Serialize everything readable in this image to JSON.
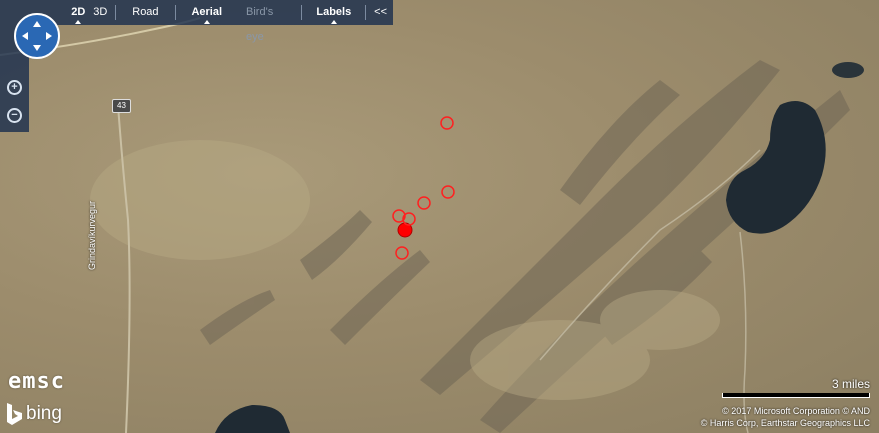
{
  "toolbar": {
    "view_2d": "2D",
    "view_3d": "3D",
    "road": "Road",
    "aerial": "Aerial",
    "birds_eye": "Bird's eye",
    "labels": "Labels",
    "collapse": "<<"
  },
  "map": {
    "route_shield": "43",
    "road_name": "Grindavíkurvegur",
    "scale_label": "3 miles",
    "copyright_line1": "© 2017 Microsoft Corporation   © AND",
    "copyright_line2": "© Harris Corp, Earthstar Geographics LLC",
    "brand_emsc": "emsc",
    "brand_bing": "bing"
  },
  "colors": {
    "toolbar_bg": "#1c304e",
    "earthquake_marker": "#ff0000",
    "water": "#1f2a33"
  },
  "earthquakes": [
    {
      "type": "main",
      "filled": true
    },
    {
      "type": "aftershock",
      "filled": false
    },
    {
      "type": "aftershock",
      "filled": false
    },
    {
      "type": "aftershock",
      "filled": false
    },
    {
      "type": "aftershock",
      "filled": false
    },
    {
      "type": "aftershock",
      "filled": false
    },
    {
      "type": "aftershock",
      "filled": false
    }
  ]
}
